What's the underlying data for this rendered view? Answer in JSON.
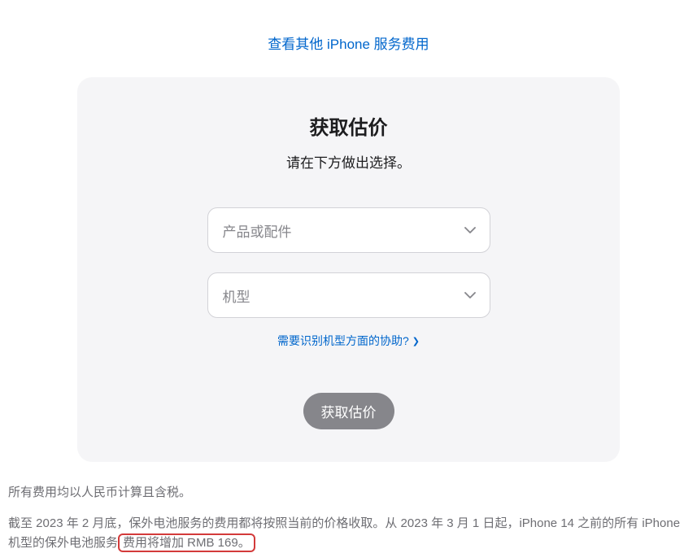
{
  "topLink": "查看其他 iPhone 服务费用",
  "card": {
    "title": "获取估价",
    "subtitle": "请在下方做出选择。",
    "select1Placeholder": "产品或配件",
    "select2Placeholder": "机型",
    "helpLink": "需要识别机型方面的协助?",
    "submitButton": "获取估价"
  },
  "footer": {
    "line1": "所有费用均以人民币计算且含税。",
    "line2Part1": "截至 2023 年 2 月底，保外电池服务的费用都将按照当前的价格收取。从 2023 年 3 月 1 日起，iPhone 14 之前的所有 iPhone 机型的保外电池服务",
    "line2Highlight": "费用将增加 RMB 169。"
  }
}
